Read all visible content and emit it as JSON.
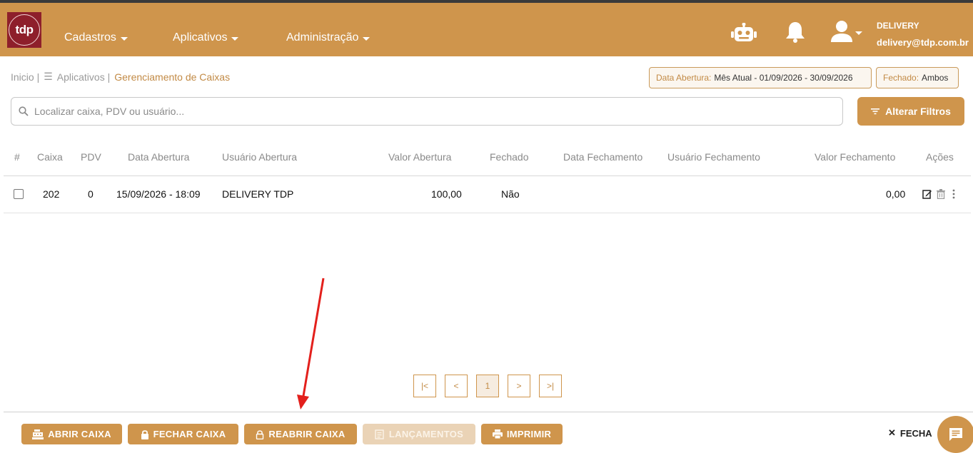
{
  "brand": {
    "logo_text": "tdp",
    "primary_color": "#cf954c",
    "logo_bg": "#8e1f2b"
  },
  "nav": {
    "menus": [
      {
        "label": "Cadastros"
      },
      {
        "label": "Aplicativos"
      },
      {
        "label": "Administração"
      }
    ],
    "user": {
      "name": "DELIVERY",
      "email": "delivery@tdp.com.br"
    }
  },
  "breadcrumb": {
    "home": "Inicio |",
    "apps": "Aplicativos |",
    "current": "Gerenciamento de Caixas"
  },
  "filters": {
    "date_key": "Data Abertura:",
    "date_value": "Mês Atual - 01/09/2026 - 30/09/2026",
    "closed_key": "Fechado:",
    "closed_value": "Ambos",
    "button": "Alterar Filtros"
  },
  "search": {
    "placeholder": "Localizar caixa, PDV ou usuário..."
  },
  "table": {
    "headers": [
      "#",
      "Caixa",
      "PDV",
      "Data Abertura",
      "Usuário Abertura",
      "Valor Abertura",
      "Fechado",
      "Data Fechamento",
      "Usuário Fechamento",
      "Valor Fechamento",
      "Ações"
    ],
    "rows": [
      {
        "caixa": "202",
        "pdv": "0",
        "data_abertura": "15/09/2026 - 18:09",
        "usuario_abertura": "DELIVERY TDP",
        "valor_abertura": "100,00",
        "fechado": "Não",
        "data_fechamento": "",
        "usuario_fechamento": "",
        "valor_fechamento": "0,00"
      }
    ]
  },
  "pagination": {
    "first": "|<",
    "prev": "<",
    "page": "1",
    "next": ">",
    "last": ">|"
  },
  "footer": {
    "abrir": "ABRIR CAIXA",
    "fechar": "FECHAR CAIXA",
    "reabrir": "REABRIR CAIXA",
    "lancamentos": "LANÇAMENTOS",
    "imprimir": "IMPRIMIR",
    "close": "FECHA"
  }
}
